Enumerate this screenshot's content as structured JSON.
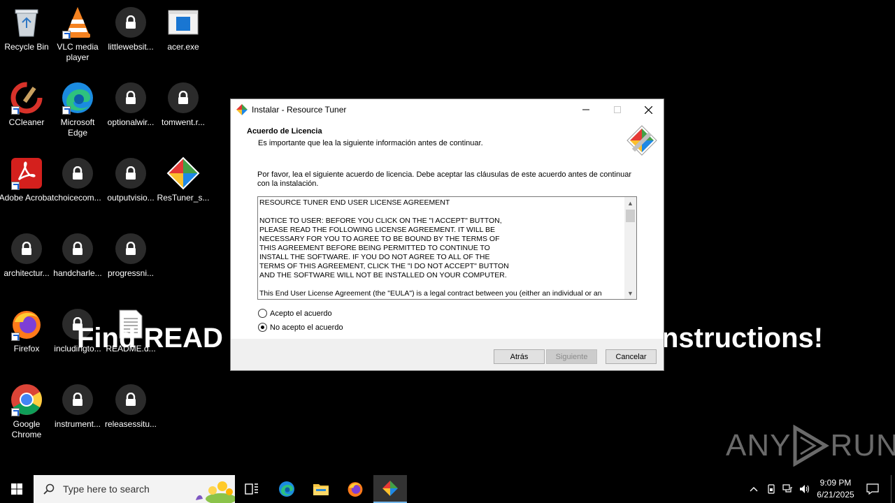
{
  "desktop": {
    "icons": [
      {
        "label": "Recycle Bin",
        "icon": "recycle-bin-icon"
      },
      {
        "label": "VLC media player",
        "icon": "vlc-icon"
      },
      {
        "label": "littlewebsit...",
        "icon": "lock-icon"
      },
      {
        "label": "acer.exe",
        "icon": "exe-icon"
      },
      {
        "label": "CCleaner",
        "icon": "ccleaner-icon"
      },
      {
        "label": "Microsoft Edge",
        "icon": "edge-icon"
      },
      {
        "label": "optionalwir...",
        "icon": "lock-icon"
      },
      {
        "label": "tomwent.r...",
        "icon": "lock-icon"
      },
      {
        "label": "Adobe Acrobat",
        "icon": "acrobat-icon"
      },
      {
        "label": "choicecom...",
        "icon": "lock-icon"
      },
      {
        "label": "outputvisio...",
        "icon": "lock-icon"
      },
      {
        "label": "ResTuner_s...",
        "icon": "restuner-icon"
      },
      {
        "label": "architectur...",
        "icon": "lock-icon"
      },
      {
        "label": "handcharle...",
        "icon": "lock-icon"
      },
      {
        "label": "progressni...",
        "icon": "lock-icon"
      },
      {
        "label": "Firefox",
        "icon": "firefox-icon"
      },
      {
        "label": "includingto...",
        "icon": "lock-icon"
      },
      {
        "label": "README.d...",
        "icon": "document-icon"
      },
      {
        "label": "Google Chrome",
        "icon": "chrome-icon"
      },
      {
        "label": "instrument...",
        "icon": "lock-icon"
      },
      {
        "label": "releasessitu...",
        "icon": "lock-icon"
      }
    ],
    "background_text_left": "Find READ",
    "background_text_right": "nstructions!"
  },
  "installer": {
    "title": "Instalar - Resource Tuner",
    "heading": "Acuerdo de Licencia",
    "subheading": "Es importante que lea la siguiente información antes de continuar.",
    "instructions": "Por favor, lea el siguiente acuerdo de licencia. Debe aceptar las cláusulas de este acuerdo antes de continuar con la instalación.",
    "license_text": "RESOURCE TUNER END USER LICENSE AGREEMENT\n\nNOTICE TO USER: BEFORE YOU CLICK ON THE \"I ACCEPT\" BUTTON,\nPLEASE READ THE FOLLOWING LICENSE AGREEMENT. IT WILL BE\nNECESSARY FOR YOU TO AGREE TO BE BOUND BY THE TERMS OF\nTHIS AGREEMENT BEFORE BEING PERMITTED TO CONTINUE TO\nINSTALL THE SOFTWARE. IF YOU DO NOT AGREE TO ALL OF THE\nTERMS OF THIS AGREEMENT, CLICK THE \"I DO NOT ACCEPT\" BUTTON\nAND THE SOFTWARE WILL NOT BE INSTALLED ON YOUR COMPUTER.\n\nThis End User License Agreement (the \"EULA\") is a legal contract between you (either an individual or an",
    "radio_accept": "Acepto el acuerdo",
    "radio_decline": "No acepto el acuerdo",
    "selected": "decline",
    "btn_back": "Atrás",
    "btn_next": "Siguiente",
    "btn_cancel": "Cancelar"
  },
  "watermark": {
    "text_left": "ANY",
    "text_right": "RUN"
  },
  "taskbar": {
    "search_placeholder": "Type here to search",
    "time": "9:09 PM",
    "date": "6/21/2025"
  }
}
